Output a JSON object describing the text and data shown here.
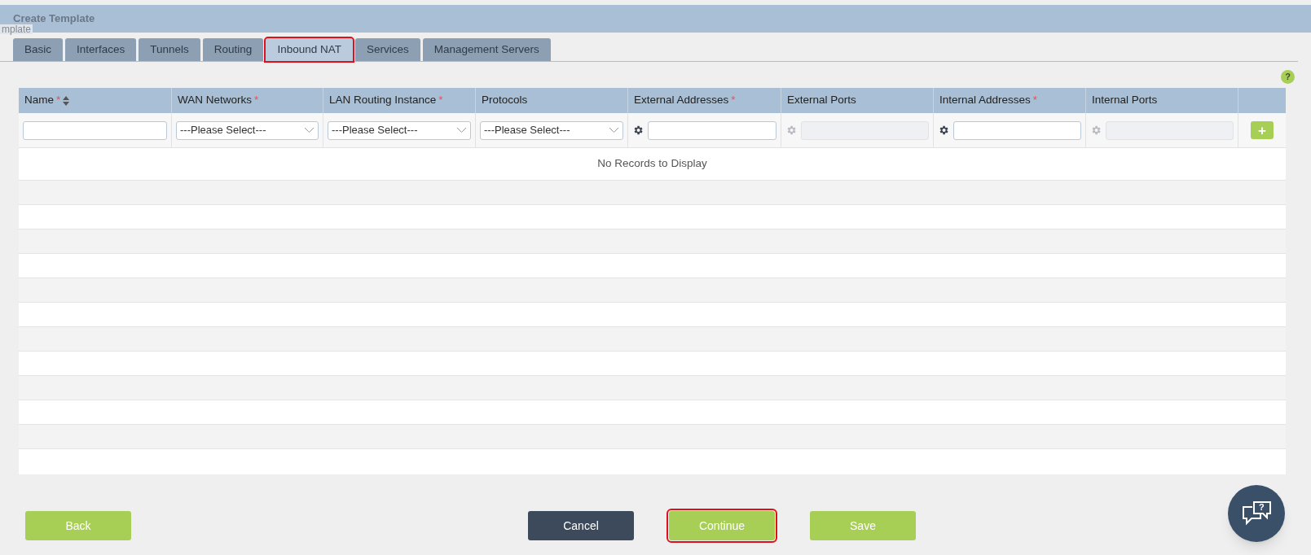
{
  "window": {
    "title": "Create Template",
    "ghost_label": "mplate"
  },
  "tabs": [
    {
      "label": "Basic",
      "selected": false,
      "highlighted": false
    },
    {
      "label": "Interfaces",
      "selected": false,
      "highlighted": false
    },
    {
      "label": "Tunnels",
      "selected": false,
      "highlighted": false
    },
    {
      "label": "Routing",
      "selected": false,
      "highlighted": false
    },
    {
      "label": "Inbound NAT",
      "selected": true,
      "highlighted": true
    },
    {
      "label": "Services",
      "selected": false,
      "highlighted": false
    },
    {
      "label": "Management Servers",
      "selected": false,
      "highlighted": false
    }
  ],
  "help_icon": "?",
  "chat_button": "?",
  "table": {
    "columns": [
      {
        "label": "Name",
        "required_mark": "*",
        "sortable": true
      },
      {
        "label": "WAN Networks",
        "required_mark": "*",
        "sortable": false
      },
      {
        "label": "LAN Routing Instance",
        "required_mark": "*",
        "sortable": false
      },
      {
        "label": "Protocols",
        "sortable": false
      },
      {
        "label": "External Addresses",
        "required_mark": "*",
        "sortable": false
      },
      {
        "label": "External Ports",
        "sortable": false
      },
      {
        "label": "Internal Addresses",
        "required_mark": "*",
        "sortable": false
      },
      {
        "label": "Internal Ports",
        "sortable": false
      }
    ],
    "input_row": [
      {
        "kind": "text",
        "disabled": false
      },
      {
        "kind": "select",
        "value": "---Please Select---",
        "disabled": false
      },
      {
        "kind": "select",
        "value": "---Please Select---",
        "disabled": false
      },
      {
        "kind": "select",
        "value": "---Please Select---",
        "disabled": false
      },
      {
        "kind": "gear-text",
        "disabled": false
      },
      {
        "kind": "gear-text",
        "disabled": true
      },
      {
        "kind": "gear-text",
        "disabled": false
      },
      {
        "kind": "gear-text",
        "disabled": true
      }
    ],
    "add_button": "+",
    "empty_message": "No Records to Display"
  },
  "buttons": [
    {
      "label": "Back",
      "kind": "primary",
      "highlighted": false
    },
    {
      "label": "Cancel",
      "kind": "dark",
      "highlighted": false
    },
    {
      "label": "Continue",
      "kind": "primary",
      "highlighted": true
    },
    {
      "label": "Save",
      "kind": "primary",
      "highlighted": false
    }
  ]
}
